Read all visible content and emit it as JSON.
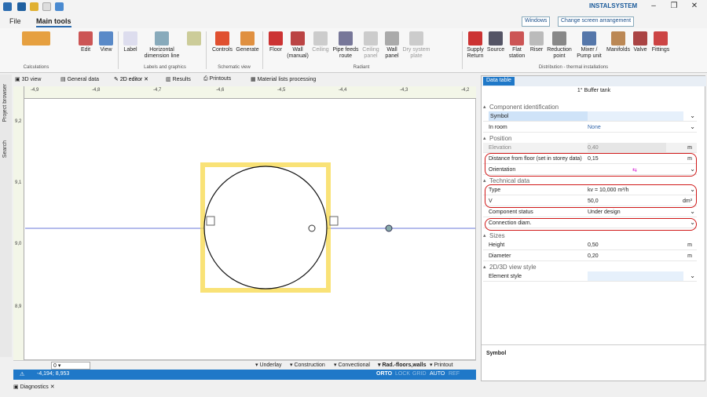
{
  "app": {
    "brand": "INSTALSYSTEM"
  },
  "menu": {
    "file": "File",
    "main_tools": "Main tools"
  },
  "topbar": {
    "windows": "Windows",
    "arrangement": "Change screen arrangement"
  },
  "ribbon": {
    "buttons": [
      {
        "label": "Edit"
      },
      {
        "label": "View"
      },
      {
        "label": "Label"
      },
      {
        "label": "Horizontal dimension line"
      },
      {
        "label": "Controls"
      },
      {
        "label": "Generate"
      },
      {
        "label": "Floor"
      },
      {
        "label": "Wall (manual)"
      },
      {
        "label": "Ceiling"
      },
      {
        "label": "Pipe feeds route"
      },
      {
        "label": "Ceiling panel"
      },
      {
        "label": "Wall panel"
      },
      {
        "label": "Dry system plate"
      },
      {
        "label": "Supply Return"
      },
      {
        "label": "Source"
      },
      {
        "label": "Flat station"
      },
      {
        "label": "Riser"
      },
      {
        "label": "Reduction point"
      },
      {
        "label": "Mixer / Pump unit"
      },
      {
        "label": "Manifolds"
      },
      {
        "label": "Valve"
      },
      {
        "label": "Fittings"
      }
    ],
    "groups": {
      "calculations": "Calculations",
      "labels": "Labels and graphics",
      "schematic": "Schematic view",
      "radiant": "Radiant",
      "distribution": "Distribution - thermal installations"
    }
  },
  "tabs": [
    {
      "label": "3D view"
    },
    {
      "label": "General data"
    },
    {
      "label": "2D editor"
    },
    {
      "label": "Results"
    },
    {
      "label": "Printouts"
    },
    {
      "label": "Material lists processing"
    }
  ],
  "sidebar": {
    "project_browser": "Project browser",
    "search": "Search"
  },
  "ruler": {
    "top": [
      "-4,9",
      "-4,8",
      "-4,7",
      "-4,6",
      "-4,5",
      "-4,4",
      "-4,3",
      "-4,2"
    ],
    "left": [
      "9,2",
      "9,1",
      "9,0",
      "8,9"
    ]
  },
  "bottom": {
    "level": "0",
    "layers": [
      "Underlay",
      "Construction",
      "Convectional",
      "Rad.-floors,walls",
      "Printout"
    ]
  },
  "status": {
    "coords": "-4,194; 8,953",
    "modes": [
      "ORTO",
      "LOCK",
      "GRID",
      "AUTO",
      "REF"
    ]
  },
  "diagnostics": "Diagnostics",
  "panel": {
    "tab": "Data table",
    "title": "1° Buffer tank",
    "sections": {
      "component": "Component identification",
      "position": "Position",
      "technical": "Technical data",
      "sizes": "Sizes",
      "style": "2D/3D view style"
    },
    "rows": {
      "symbol": {
        "label": "Symbol",
        "value": ""
      },
      "in_room": {
        "label": "In room",
        "value": "None"
      },
      "elevation": {
        "label": "Elevation",
        "value": "0,40",
        "unit": "m"
      },
      "distance": {
        "label": "Distance from floor (set in storey data)",
        "value": "0,15",
        "unit": "m"
      },
      "orientation": {
        "label": "Orientation",
        "value": "⇆"
      },
      "type": {
        "label": "Type",
        "value": "kv = 10,000 m³/h"
      },
      "v": {
        "label": "V",
        "value": "50,0",
        "unit": "dm³"
      },
      "status": {
        "label": "Component status",
        "value": "Under design"
      },
      "connection": {
        "label": "Connection diam.",
        "value": ""
      },
      "height": {
        "label": "Height",
        "value": "0,50",
        "unit": "m"
      },
      "diameter": {
        "label": "Diameter",
        "value": "0,20",
        "unit": "m"
      },
      "element_style": {
        "label": "Element style",
        "value": ""
      }
    },
    "description": "Symbol"
  }
}
